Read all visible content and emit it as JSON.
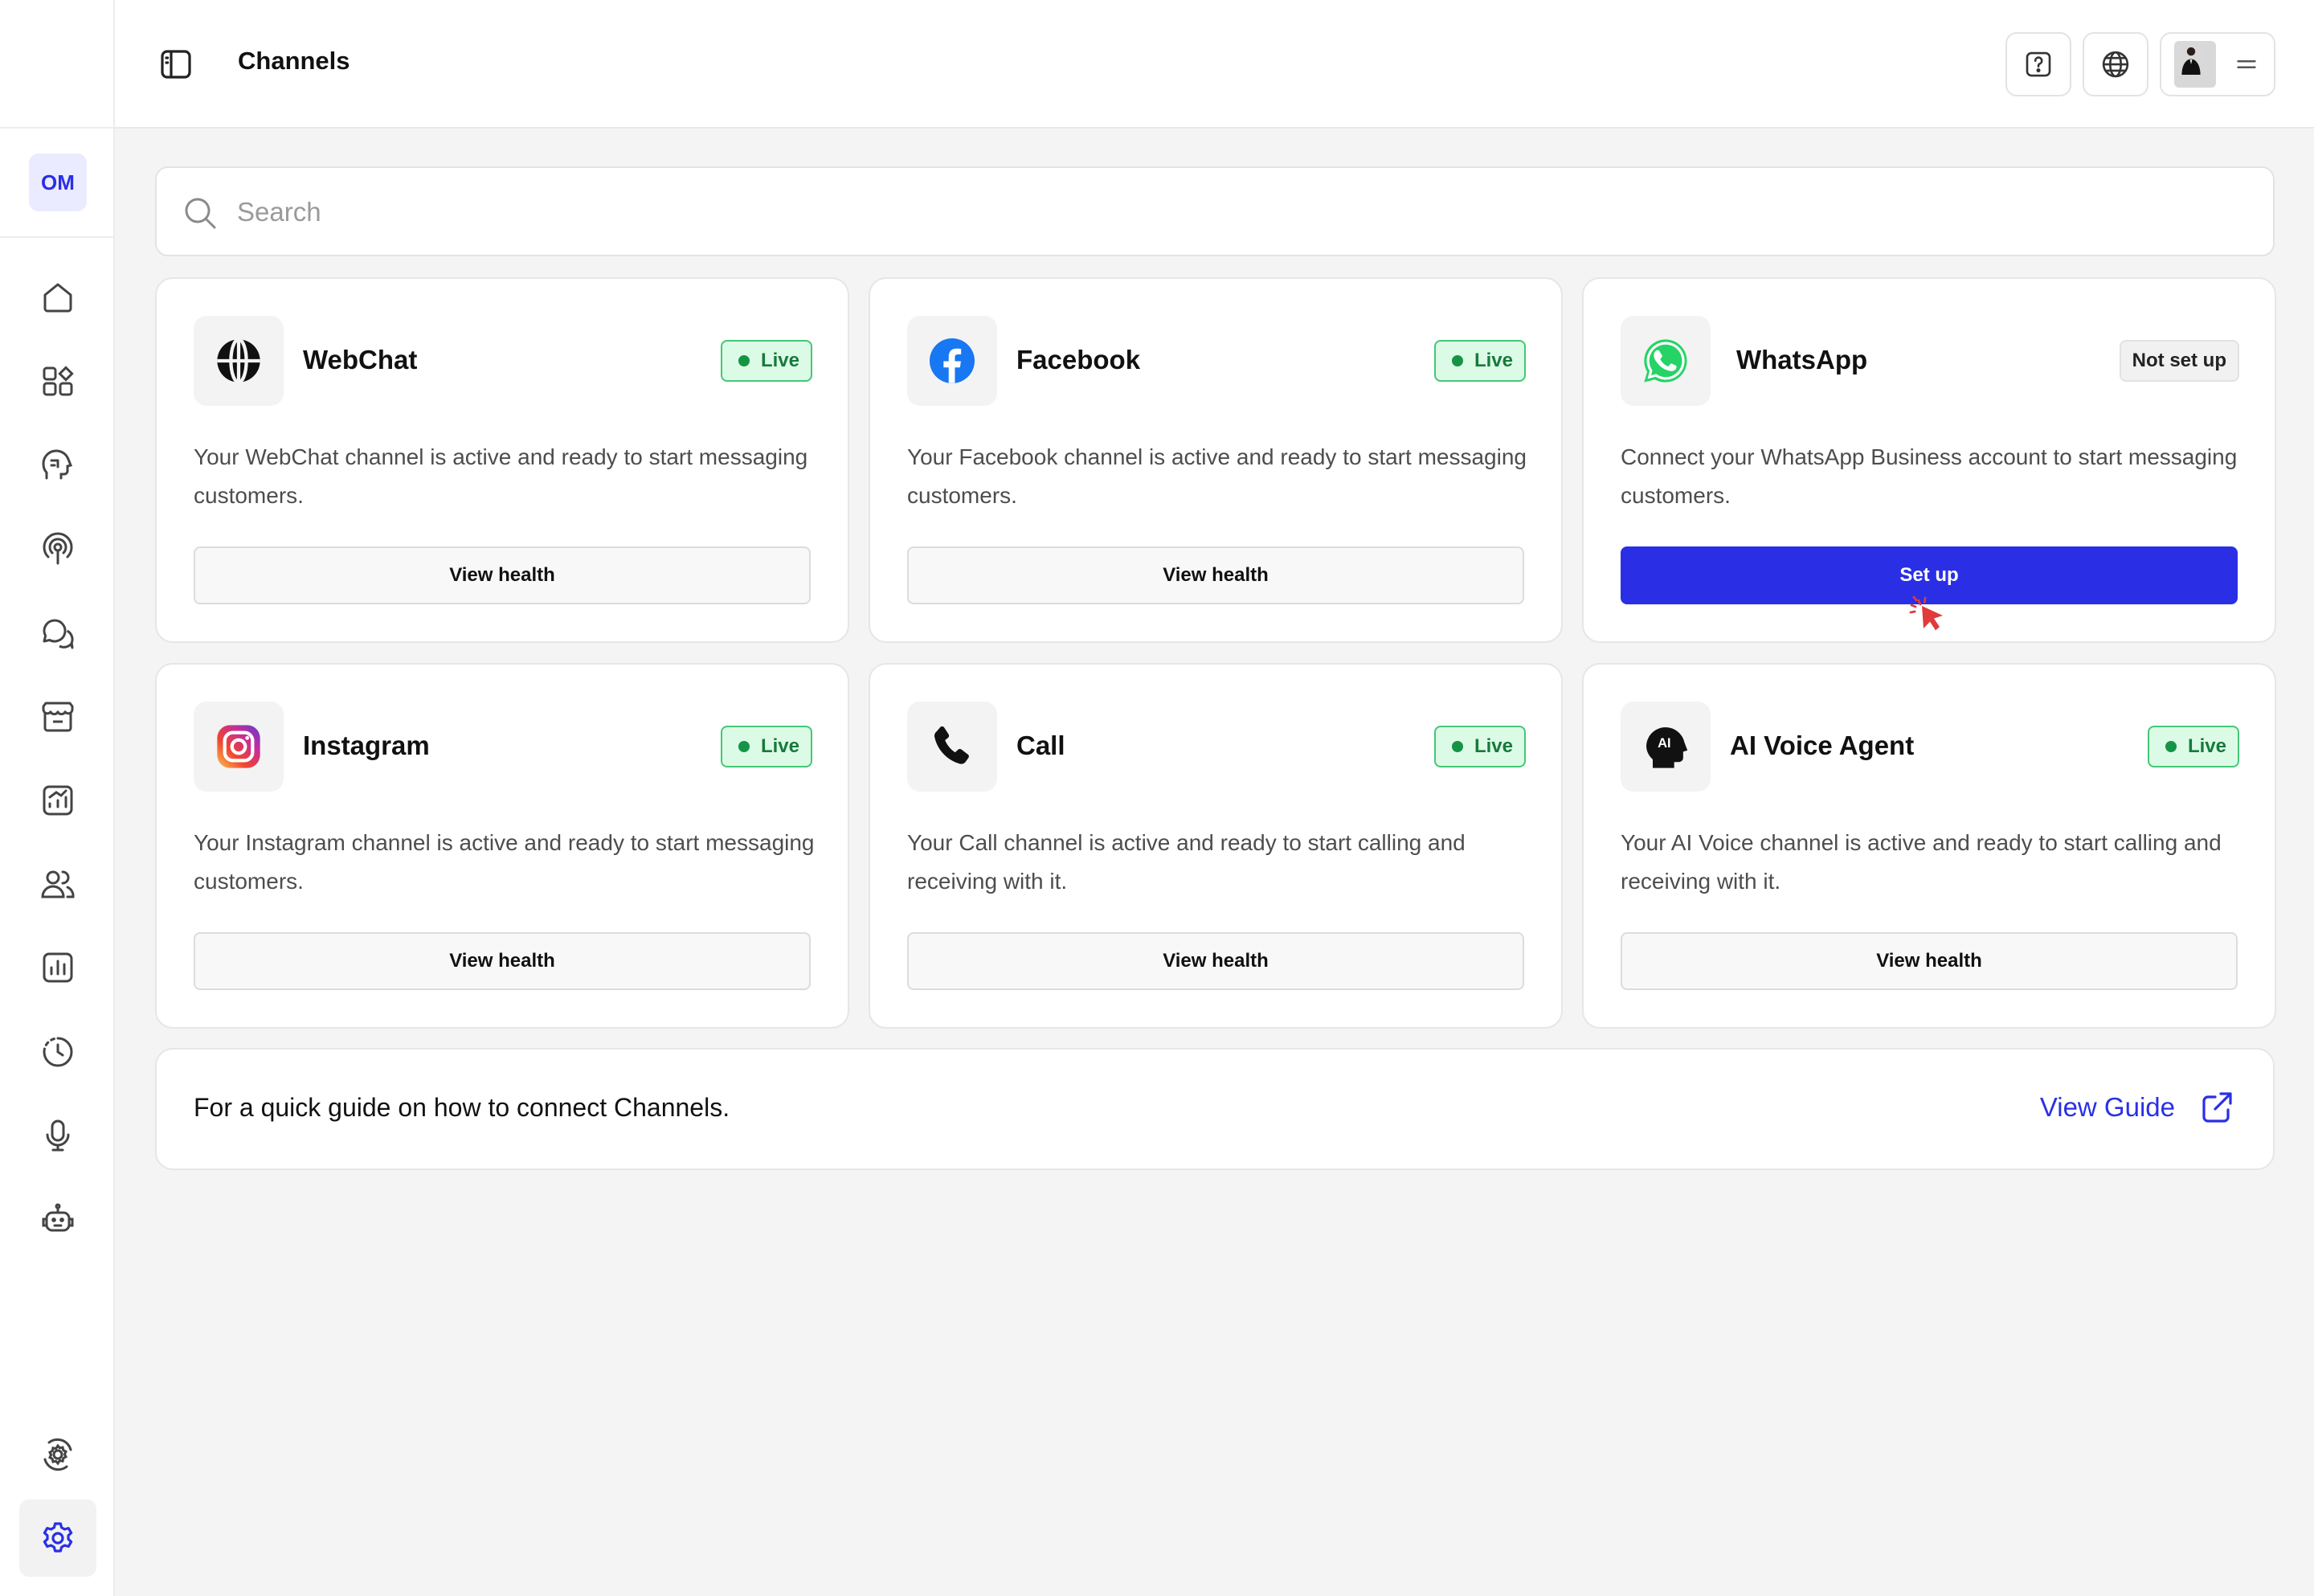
{
  "sidebar": {
    "workspace_initials": "OM",
    "nav": [
      {
        "icon": "home-icon"
      },
      {
        "icon": "apps-icon"
      },
      {
        "icon": "ai-head-icon"
      },
      {
        "icon": "broadcast-icon"
      },
      {
        "icon": "chat-bubbles-icon"
      },
      {
        "icon": "store-icon"
      },
      {
        "icon": "analytics-up-icon"
      },
      {
        "icon": "contacts-icon"
      },
      {
        "icon": "bar-chart-icon"
      },
      {
        "icon": "history-icon"
      },
      {
        "icon": "microphone-icon"
      },
      {
        "icon": "bot-icon"
      },
      {
        "icon": "integrations-gear-icon"
      },
      {
        "icon": "settings-gear-icon",
        "active": true
      }
    ]
  },
  "header": {
    "title": "Channels"
  },
  "search": {
    "placeholder": "Search"
  },
  "channels": [
    {
      "name": "WebChat",
      "status": "Live",
      "description": "Your WebChat channel is active and ready to start messaging customers.",
      "action": "View health",
      "icon": "globe-icon"
    },
    {
      "name": "Facebook",
      "status": "Live",
      "description": "Your Facebook channel is active and ready to start messaging customers.",
      "action": "View health",
      "icon": "facebook-icon"
    },
    {
      "name": "WhatsApp",
      "status": "Not set up",
      "description": "Connect your WhatsApp Business account to start messaging customers.",
      "action": "Set up",
      "icon": "whatsapp-icon"
    },
    {
      "name": "Instagram",
      "status": "Live",
      "description": "Your Instagram channel is active and ready to start messaging customers.",
      "action": "View health",
      "icon": "instagram-icon"
    },
    {
      "name": "Call",
      "status": "Live",
      "description": "Your Call channel is active and ready to start calling and receiving with it.",
      "action": "View health",
      "icon": "phone-icon"
    },
    {
      "name": "AI Voice Agent",
      "status": "Live",
      "description": "Your AI Voice channel is active and ready to start calling and receiving with it.",
      "action": "View health",
      "icon": "ai-voice-icon"
    }
  ],
  "guide": {
    "text": "For a quick guide on how to connect Channels.",
    "link_label": "View Guide"
  },
  "colors": {
    "accent": "#2a2fe6",
    "live_bg": "#dcfbe6",
    "live_border": "#44c776",
    "live_text": "#167a3c"
  }
}
